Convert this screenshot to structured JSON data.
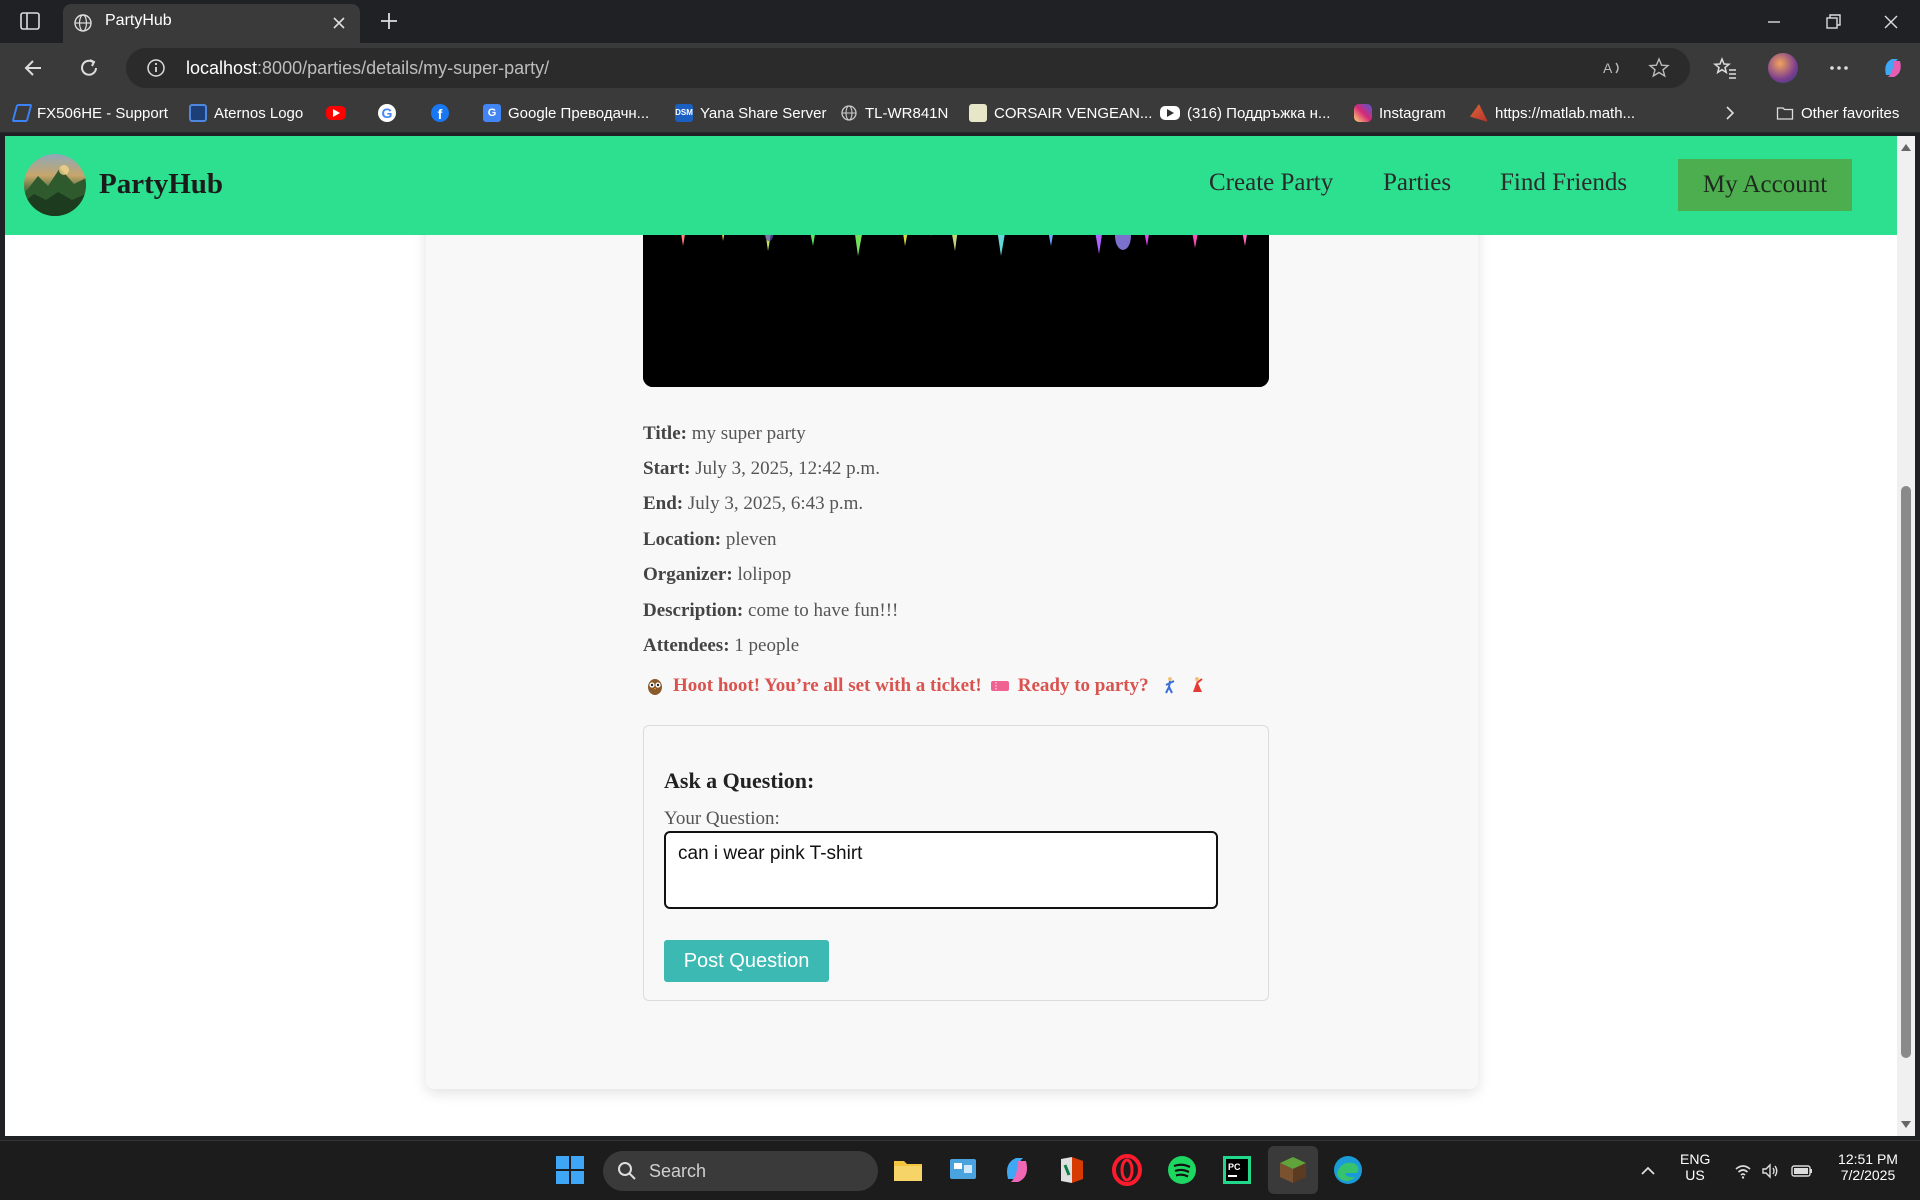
{
  "browser": {
    "tab_title": "PartyHub",
    "url_host": "localhost",
    "url_path": ":8000/parties/details/my-super-party/",
    "bookmarks": [
      {
        "label": "FX506HE - Support",
        "icon": "asus-icon",
        "color": "#3b82f6"
      },
      {
        "label": "Aternos Logo",
        "icon": "aternos-icon",
        "color": "#2f6fd1"
      },
      {
        "label": "",
        "icon": "youtube-icon",
        "color": "#ff0000"
      },
      {
        "label": "",
        "icon": "google-icon",
        "color": "#ffffff"
      },
      {
        "label": "",
        "icon": "facebook-icon",
        "color": "#1877f2"
      },
      {
        "label": "Google Преводачн...",
        "icon": "google-translate-icon",
        "color": "#4285f4"
      },
      {
        "label": "Yana Share Server",
        "icon": "dsm-icon",
        "color": "#1b5fc1"
      },
      {
        "label": "TL-WR841N",
        "icon": "globe-icon",
        "color": "#cccccc"
      },
      {
        "label": "CORSAIR VENGEAN...",
        "icon": "corsair-icon",
        "color": "#e8e6c8"
      },
      {
        "label": "(316) Поддръжка н...",
        "icon": "youtube-icon",
        "color": "#ffffff"
      },
      {
        "label": "Instagram",
        "icon": "instagram-icon",
        "color": "#e1306c"
      },
      {
        "label": "https://matlab.math...",
        "icon": "matlab-icon",
        "color": "#e16737"
      }
    ],
    "other_favorites": "Other favorites"
  },
  "navbar": {
    "brand": "PartyHub",
    "links": [
      "Create Party",
      "Parties",
      "Find Friends"
    ],
    "account": "My Account",
    "bg_color": "#2de090"
  },
  "party": {
    "fields": [
      {
        "label": "Title:",
        "value": "my super party"
      },
      {
        "label": "Start:",
        "value": "July 3, 2025, 12:42 p.m."
      },
      {
        "label": "End:",
        "value": "July 3, 2025, 6:43 p.m."
      },
      {
        "label": "Location:",
        "value": "pleven"
      },
      {
        "label": "Organizer:",
        "value": "lolipop"
      },
      {
        "label": "Description:",
        "value": "come to have fun!!!"
      },
      {
        "label": "Attendees:",
        "value": "1 people"
      }
    ],
    "ticket_msg_1": "Hoot hoot! You’re all set with a ticket!",
    "ticket_msg_2": "Ready to party?"
  },
  "question_form": {
    "title": "Ask a Question:",
    "label": "Your Question:",
    "value": "can i wear pink T-shirt",
    "submit": "Post Question"
  },
  "taskbar": {
    "search": "Search",
    "lang_1": "ENG",
    "lang_2": "US",
    "time": "12:51 PM",
    "date": "7/2/2025"
  }
}
